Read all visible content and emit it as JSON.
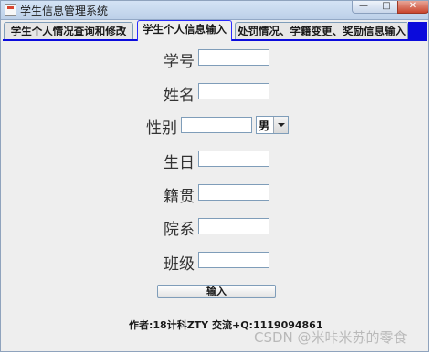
{
  "window": {
    "title": "学生信息管理系统",
    "controls": {
      "minimize": "—",
      "maximize": "□",
      "close": "✕"
    }
  },
  "tabs": [
    {
      "label": "学生个人情况查询和修改",
      "selected": false
    },
    {
      "label": "学生个人信息输入",
      "selected": true
    },
    {
      "label": "处罚情况、学籍变更、奖励信息输入",
      "selected": false
    }
  ],
  "form": {
    "student_id_label": "学号",
    "student_id_value": "",
    "name_label": "姓名",
    "name_value": "",
    "gender_label": "性别",
    "gender_value": "",
    "gender_selected": "男",
    "birthday_label": "生日",
    "birthday_value": "",
    "hometown_label": "籍贯",
    "hometown_value": "",
    "department_label": "院系",
    "department_value": "",
    "class_label": "班级",
    "class_value": "",
    "submit_label": "输入"
  },
  "footer": {
    "text": "作者:18计科ZTY 交流+Q:1119094861"
  },
  "watermark": {
    "text": "CSDN @米咔米苏的零食"
  },
  "colors": {
    "tab_accent": "#0b0bdc",
    "panel_bg": "#eeeeee"
  }
}
